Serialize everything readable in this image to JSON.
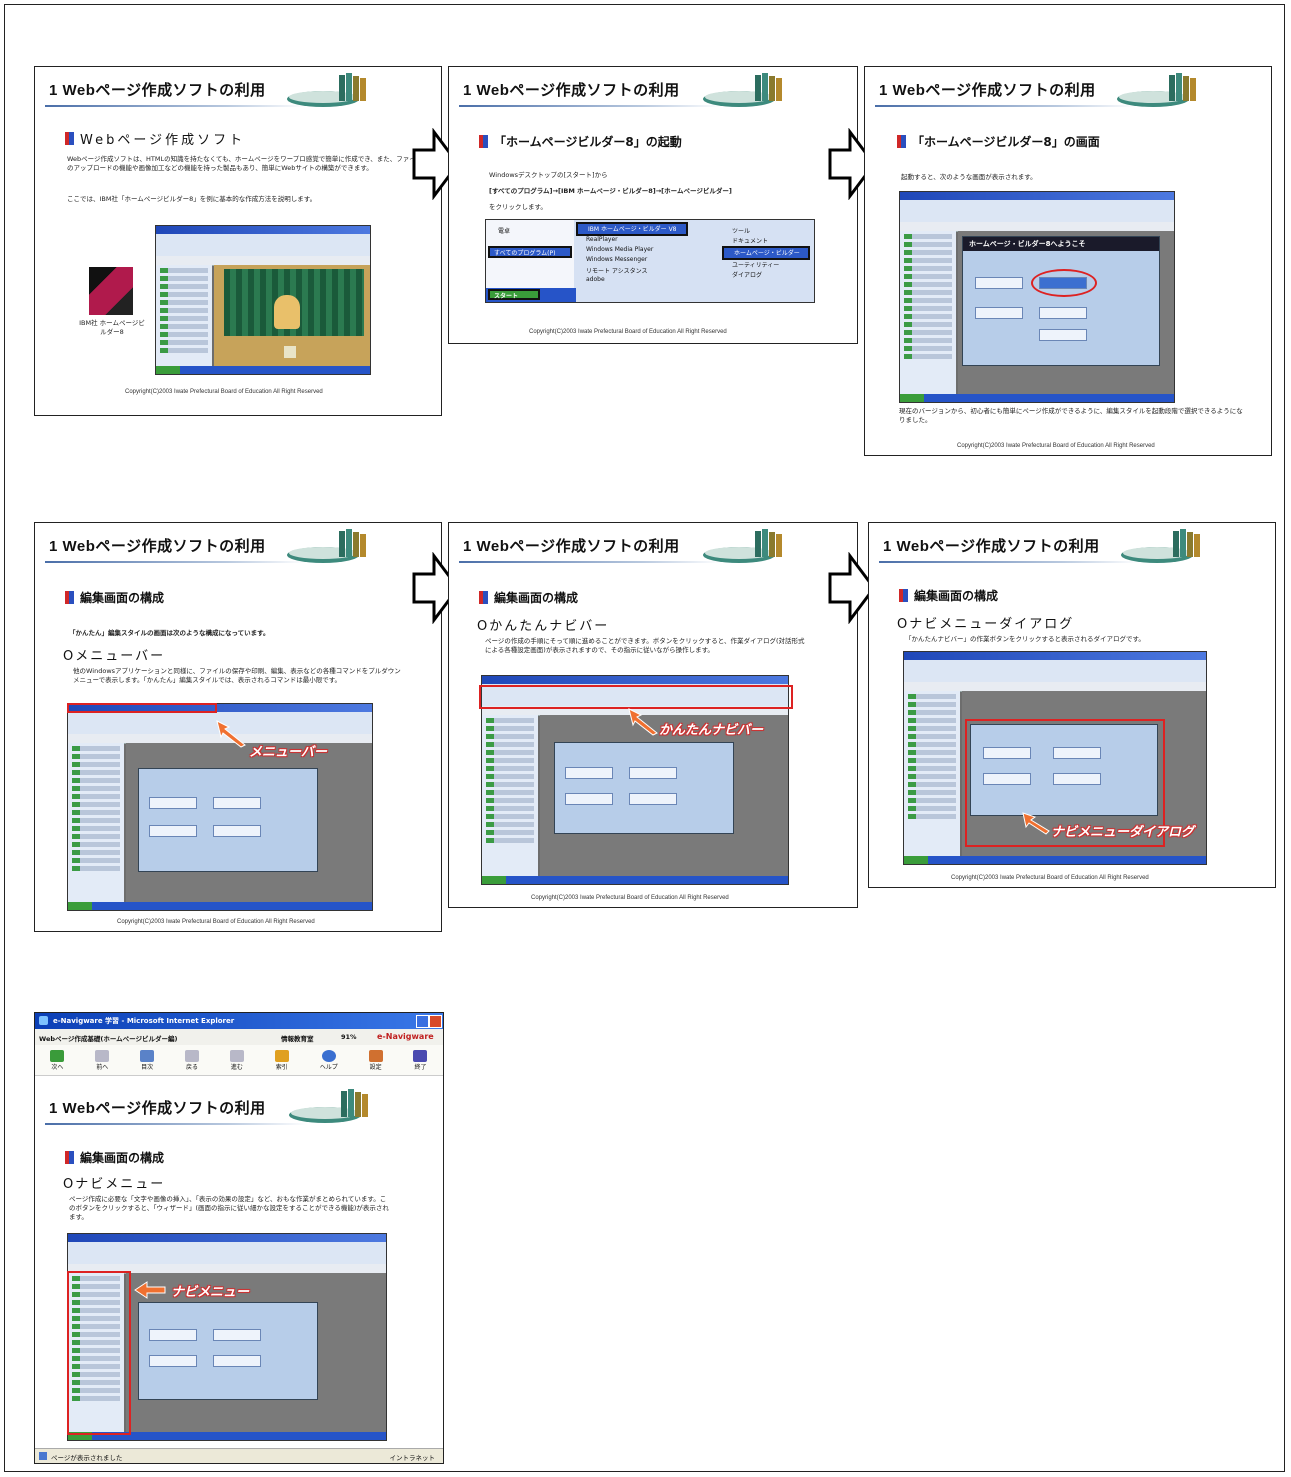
{
  "slide_title": "1 Webページ作成ソフトの利用",
  "copyright": "Copyright(C)2003 Iwate Prefectural Board of Education All Right Reserved",
  "slide1": {
    "heading": "Webページ作成ソフト",
    "para1": "Webページ作成ソフトは、HTMLの知識を持たなくても、ホームページをワープロ感覚で簡単に作成でき、また、ファイルのアップロードの機能や画像加工などの機能を持った製品もあり、簡単にWebサイトの構築ができます。",
    "para2": "ここでは、IBM社「ホームページビルダー8」を例に基本的な作成方法を説明します。",
    "box_caption": "IBM社 ホームページビルダー8"
  },
  "slide2": {
    "heading": "「ホームページビルダー8」の起動",
    "line1": "Windowsデスクトップの[スタート]から",
    "line2": "[すべてのプログラム]→[IBM ホームページ・ビルダー8]→[ホームページビルダー]",
    "line3": "をクリックします。",
    "menu_left": [
      "電卓",
      "すべてのプログラム(P)"
    ],
    "start_label": "スタート",
    "menu_mid": [
      "IBM ホームページ・ビルダー V8",
      "RealPlayer",
      "Windows Media Player",
      "Windows Messenger",
      "リモート アシスタンス",
      "adobe"
    ],
    "menu_right": [
      "ツール",
      "ドキュメント",
      "ホームページ・ビルダー",
      "ユーティリティー",
      "ダイアログ"
    ]
  },
  "slide3": {
    "heading": "「ホームページビルダー8」の画面",
    "intro": "起動すると、次のような画面が表示されます。",
    "welcome": "ホームページ・ビルダー8へようこそ",
    "note": "現在のバージョンから、初心者にも簡単にページ作成ができるように、編集スタイルを起動段階で選択できるようになりました。"
  },
  "slide4": {
    "heading": "編集画面の構成",
    "intro": "「かんたん」編集スタイルの画面は次のような構成になっています。",
    "subheading": "Oメニューバー",
    "para": "他のWindowsアプリケーションと同様に、ファイルの保存や印刷、編集、表示などの各種コマンドをプルダウンメニューで表示します。「かんたん」編集スタイルでは、表示されるコマンドは最小限です。",
    "callout": "メニューバー"
  },
  "slide5": {
    "heading": "編集画面の構成",
    "subheading": "Oかんたんナビバー",
    "para": "ページの作成の手順にそって順に進めることができます。ボタンをクリックすると、作業ダイアログ(対話形式による各種設定画面)が表示されますので、その指示に従いながら操作します。",
    "callout": "かんたんナビバー"
  },
  "slide6": {
    "heading": "編集画面の構成",
    "subheading": "Oナビメニューダイアログ",
    "intro": "「かんたんナビバー」の作業ボタンをクリックすると表示されるダイアログです。",
    "callout": "ナビメニューダイアログ"
  },
  "slide7": {
    "window_title": "e-Navigware 学習 - Microsoft Internet Explorer",
    "course": "Webページ作成基礎(ホームページビルダー編)",
    "dept": "情報教育室",
    "progress": "91%",
    "brand": "e-Navigware",
    "toolbar": [
      "次へ",
      "前へ",
      "目次",
      "戻る",
      "進む",
      "索引",
      "ヘルプ",
      "設定",
      "終了"
    ],
    "heading": "編集画面の構成",
    "subheading": "Oナビメニュー",
    "para": "ページ作成に必要な「文字や画像の挿入」、「表示の効果の設定」など、おもな作業がまとめられています。このボタンをクリックすると、「ウィザード」(画面の指示に従い細かな設定をすることができる機能)が表示されます。",
    "callout": "ナビメニュー",
    "status_left": "ページが表示されました",
    "status_right": "イントラネット"
  },
  "colors": {
    "accent_red": "#d22222",
    "title_blue": "#1f47b8",
    "callout_orange": "#f07030"
  }
}
